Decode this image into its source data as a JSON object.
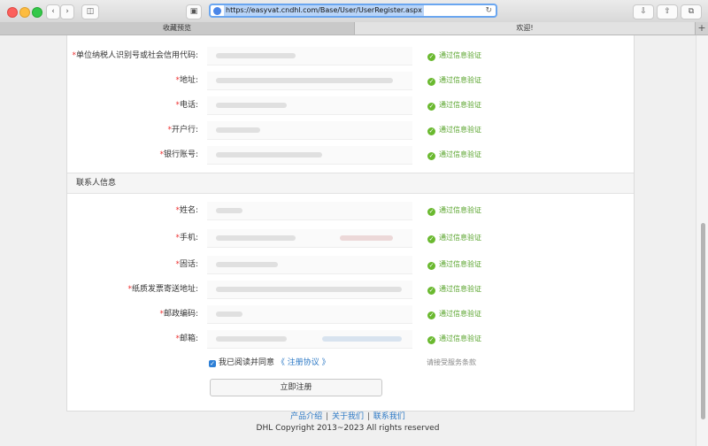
{
  "browser": {
    "url": "https://easyvat.cndhl.com/Base/User/UserRegister.aspx",
    "tabs": [
      {
        "label": "收藏预览"
      },
      {
        "label": "欢迎!"
      }
    ]
  },
  "form": {
    "company_fields": [
      {
        "label": "单位纳税人识别号或社会信用代码:",
        "status": "通过信息验证"
      },
      {
        "label": "地址:",
        "status": "通过信息验证"
      },
      {
        "label": "电话:",
        "status": "通过信息验证"
      },
      {
        "label": "开户行:",
        "status": "通过信息验证"
      },
      {
        "label": "银行账号:",
        "status": "通过信息验证"
      }
    ],
    "contact_section_title": "联系人信息",
    "contact_fields": [
      {
        "label": "姓名:",
        "status": "通过信息验证"
      },
      {
        "label": "手机:",
        "status": "通过信息验证"
      },
      {
        "label": "固话:",
        "status": "通过信息验证"
      },
      {
        "label": "纸质发票寄送地址:",
        "status": "通过信息验证"
      },
      {
        "label": "邮政编码:",
        "status": "通过信息验证"
      },
      {
        "label": "邮箱:",
        "status": "通过信息验证"
      }
    ],
    "required_mark": "*",
    "agree_text": "我已阅读并同意",
    "agreement_link": "《 注册协议 》",
    "accept_hint": "请接受服务条款",
    "submit_label": "立即注册"
  },
  "footer": {
    "links": [
      "产品介绍",
      "关于我们",
      "联系我们"
    ],
    "separator": "|",
    "copyright": "DHL Copyright 2013~2023 All rights reserved"
  }
}
